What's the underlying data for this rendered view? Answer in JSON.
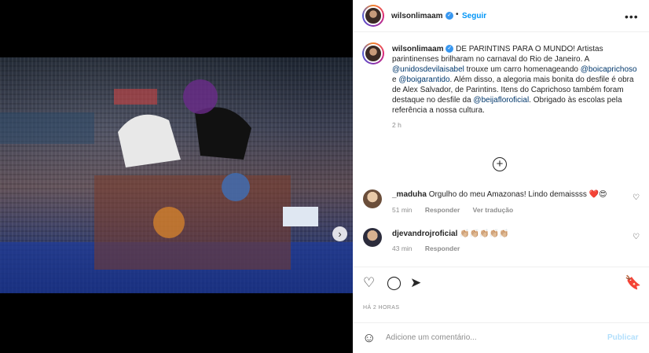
{
  "post": {
    "username": "wilsonlimaam",
    "follow_label": "Seguir",
    "more_icon": "more-horizontal-icon",
    "caption": {
      "text1": "DE PARINTINS PARA O MUNDO! Artistas parintinenses brilharam no carnaval do Rio de Janeiro. A ",
      "mention1": "@unidosdevilaisabel",
      "text2": " trouxe um carro homenageando ",
      "mention2": "@boicaprichoso",
      "text3": " e ",
      "mention3": "@boigarantido",
      "text4": ". Além disso, a alegoria mais bonita do desfile é obra de Alex Salvador, de Parintins. Itens do Caprichoso também foram destaque no desfile da ",
      "mention4": "@beijafloroficial",
      "text5": ". Obrigado às escolas pela referência a nossa cultura.",
      "time": "2 h"
    },
    "date": "HÁ 2 HORAS"
  },
  "comments": [
    {
      "username": "_maduha",
      "text": "Orgulho do meu Amazonas! Lindo demaissss ❤️😍",
      "time": "51 min",
      "reply": "Responder",
      "translate": "Ver tradução"
    },
    {
      "username": "djevandrojroficial",
      "text": "👏🏼👏🏼👏🏼👏🏼👏🏼",
      "time": "43 min",
      "reply": "Responder"
    }
  ],
  "add_comment": {
    "placeholder": "Adicione um comentário...",
    "post_label": "Publicar"
  },
  "colors": {
    "accent": "#0095f6",
    "mention": "#00376b",
    "muted": "#8e8e8e",
    "post_disabled": "#b2dffc"
  }
}
